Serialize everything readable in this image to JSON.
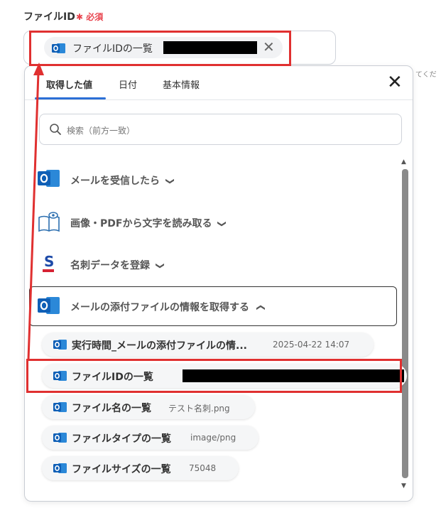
{
  "field": {
    "label": "ファイルID",
    "required": "必須"
  },
  "selected_chip": {
    "label": "ファイルIDの一覧"
  },
  "cut_text": "てくだ",
  "tabs": [
    {
      "label": "取得した値"
    },
    {
      "label": "日付"
    },
    {
      "label": "基本情報"
    }
  ],
  "search": {
    "placeholder": "検索（前方一致）"
  },
  "groups": [
    {
      "label": "メールを受信したら",
      "icon": "outlook-icon"
    },
    {
      "label": "画像・PDFから文字を読み取る",
      "icon": "book-eye-icon"
    },
    {
      "label": "名刺データを登録",
      "icon": "sansan-icon"
    },
    {
      "label": "メールの添付ファイルの情報を取得する",
      "icon": "outlook-icon"
    }
  ],
  "values": [
    {
      "label": "実行時間_メールの添付ファイルの情...",
      "value": "2025-04-22 14:07"
    },
    {
      "label": "ファイルIDの一覧",
      "value": ""
    },
    {
      "label": "ファイル名の一覧",
      "value": "テスト名刺.png"
    },
    {
      "label": "ファイルタイプの一覧",
      "value": "image/png"
    },
    {
      "label": "ファイルサイズの一覧",
      "value": "75048"
    }
  ],
  "colors": {
    "accent": "#2c6fd6",
    "annotation_red": "#e03030",
    "required_red": "#e8434d",
    "outlook_blue": "#0f5fb6"
  }
}
